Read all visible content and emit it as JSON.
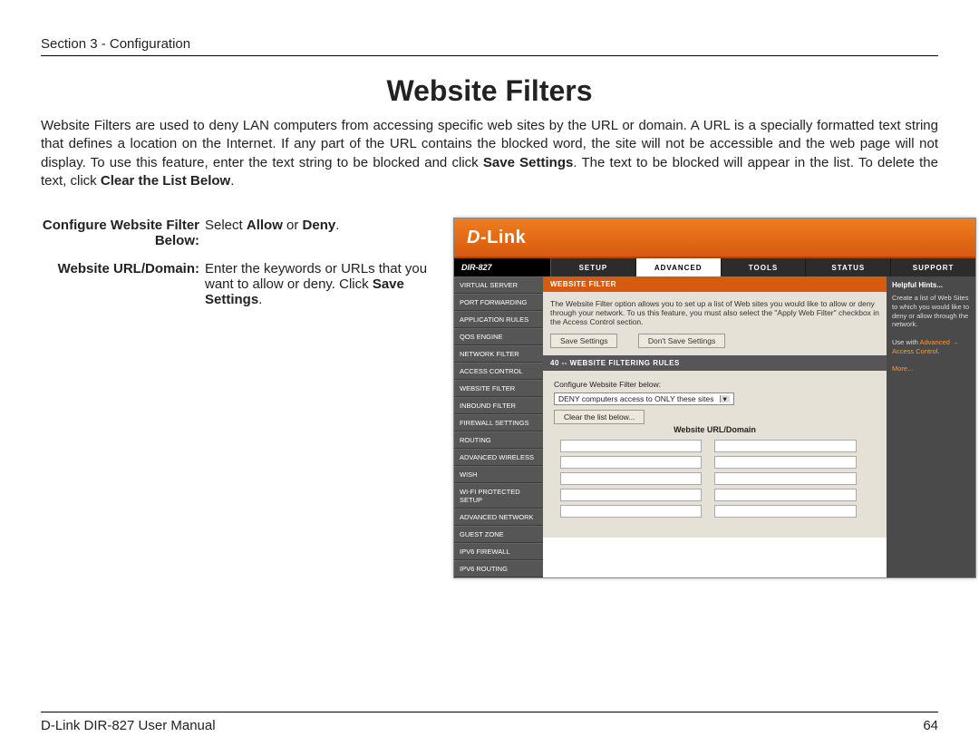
{
  "header": {
    "section": "Section 3 - Configuration"
  },
  "title": "Website Filters",
  "intro": {
    "p1a": "Website Filters are used to deny LAN computers from accessing specific web sites by the URL or domain. A URL is a specially formatted text string that defines a location on the Internet. If any part of the URL contains the blocked word, the site will not be accessible and the web page will not display. To use this feature, enter the text string to be blocked and click ",
    "p1b": "Save Settings",
    "p1c": ". The text to be blocked will appear in the list. To delete the text, click ",
    "p1d": "Clear the List Below",
    "p1e": "."
  },
  "defs": {
    "label1": "Configure Website Filter Below:",
    "val1a": "Select ",
    "val1b": "Allow",
    "val1c": " or ",
    "val1d": "Deny",
    "val1e": ".",
    "label2": "Website URL/Domain:",
    "val2a": "Enter the keywords or URLs that you want to allow or deny. Click ",
    "val2b": "Save Settings",
    "val2c": "."
  },
  "router": {
    "brand": "D-Link",
    "model": "DIR-827",
    "tabs": [
      "SETUP",
      "ADVANCED",
      "TOOLS",
      "STATUS",
      "SUPPORT"
    ],
    "active_tab": 1,
    "sidebar": [
      "VIRTUAL SERVER",
      "PORT FORWARDING",
      "APPLICATION RULES",
      "QOS ENGINE",
      "NETWORK FILTER",
      "ACCESS CONTROL",
      "WEBSITE FILTER",
      "INBOUND FILTER",
      "FIREWALL SETTINGS",
      "ROUTING",
      "ADVANCED WIRELESS",
      "WISH",
      "WI-FI PROTECTED SETUP",
      "ADVANCED NETWORK",
      "GUEST ZONE",
      "IPV6 FIREWALL",
      "IPV6 ROUTING"
    ],
    "panel_title": "WEBSITE FILTER",
    "panel_text": "The Website Filter option allows you to set up a list of Web sites you would like to allow or deny through your network. To us this feature, you must also select the \"Apply Web Filter\" checkbox in the Access Control section.",
    "btn_save": "Save Settings",
    "btn_cancel": "Don't Save Settings",
    "rules_title": "40 -- WEBSITE FILTERING RULES",
    "configure_label": "Configure Website Filter below:",
    "select_value": "DENY computers access to ONLY these sites",
    "clear_btn": "Clear the list below...",
    "table_header": "Website URL/Domain",
    "hints_title": "Helpful Hints...",
    "hints_p1": "Create a list of Web Sites to which you would like to deny or allow through the network.",
    "hints_p2a": "Use with ",
    "hints_p2b": "Advanced → Access Control",
    "hints_p2c": ".",
    "hints_more": "More..."
  },
  "footer": {
    "left": "D-Link DIR-827 User Manual",
    "right": "64"
  }
}
